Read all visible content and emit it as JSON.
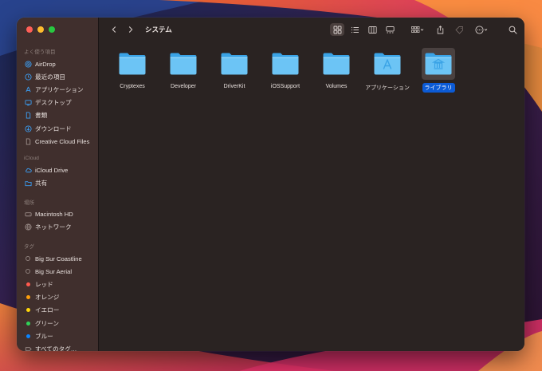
{
  "window": {
    "title": "システム"
  },
  "sidebar": {
    "sections": [
      {
        "label": "よく使う項目",
        "items": [
          {
            "label": "AirDrop",
            "icon": "airdrop-icon"
          },
          {
            "label": "最近の項目",
            "icon": "clock-icon"
          },
          {
            "label": "アプリケーション",
            "icon": "apps-icon"
          },
          {
            "label": "デスクトップ",
            "icon": "desktop-icon"
          },
          {
            "label": "書類",
            "icon": "document-icon"
          },
          {
            "label": "ダウンロード",
            "icon": "download-icon"
          },
          {
            "label": "Creative Cloud Files",
            "icon": "file-icon"
          }
        ]
      },
      {
        "label": "iCloud",
        "items": [
          {
            "label": "iCloud Drive",
            "icon": "cloud-icon"
          },
          {
            "label": "共有",
            "icon": "shared-folder-icon"
          }
        ]
      },
      {
        "label": "場所",
        "items": [
          {
            "label": "Macintosh HD",
            "icon": "disk-icon"
          },
          {
            "label": "ネットワーク",
            "icon": "network-icon"
          }
        ]
      },
      {
        "label": "タグ",
        "items": [
          {
            "label": "Big Sur Coastline",
            "tag": "ring"
          },
          {
            "label": "Big Sur Aerial",
            "tag": "ring"
          },
          {
            "label": "レッド",
            "tag": "#ff5a4e"
          },
          {
            "label": "オレンジ",
            "tag": "#ff9f0a"
          },
          {
            "label": "イエロー",
            "tag": "#ffd60a"
          },
          {
            "label": "グリーン",
            "tag": "#30d158"
          },
          {
            "label": "ブルー",
            "tag": "#0a84ff"
          },
          {
            "label": "すべてのタグ…",
            "icon": "all-tags-icon"
          }
        ]
      }
    ]
  },
  "files": [
    {
      "name": "Cryptexes",
      "badge": ""
    },
    {
      "name": "Developer",
      "badge": ""
    },
    {
      "name": "DriverKit",
      "badge": ""
    },
    {
      "name": "iOSSupport",
      "badge": ""
    },
    {
      "name": "Volumes",
      "badge": ""
    },
    {
      "name": "アプリケーション",
      "badge": "apps"
    },
    {
      "name": "ライブラリ",
      "badge": "library",
      "selected": true
    }
  ],
  "colors": {
    "folder_light": "#6cc4f5",
    "folder_dark": "#3aa3e6",
    "selection": "#0c5bd6"
  }
}
